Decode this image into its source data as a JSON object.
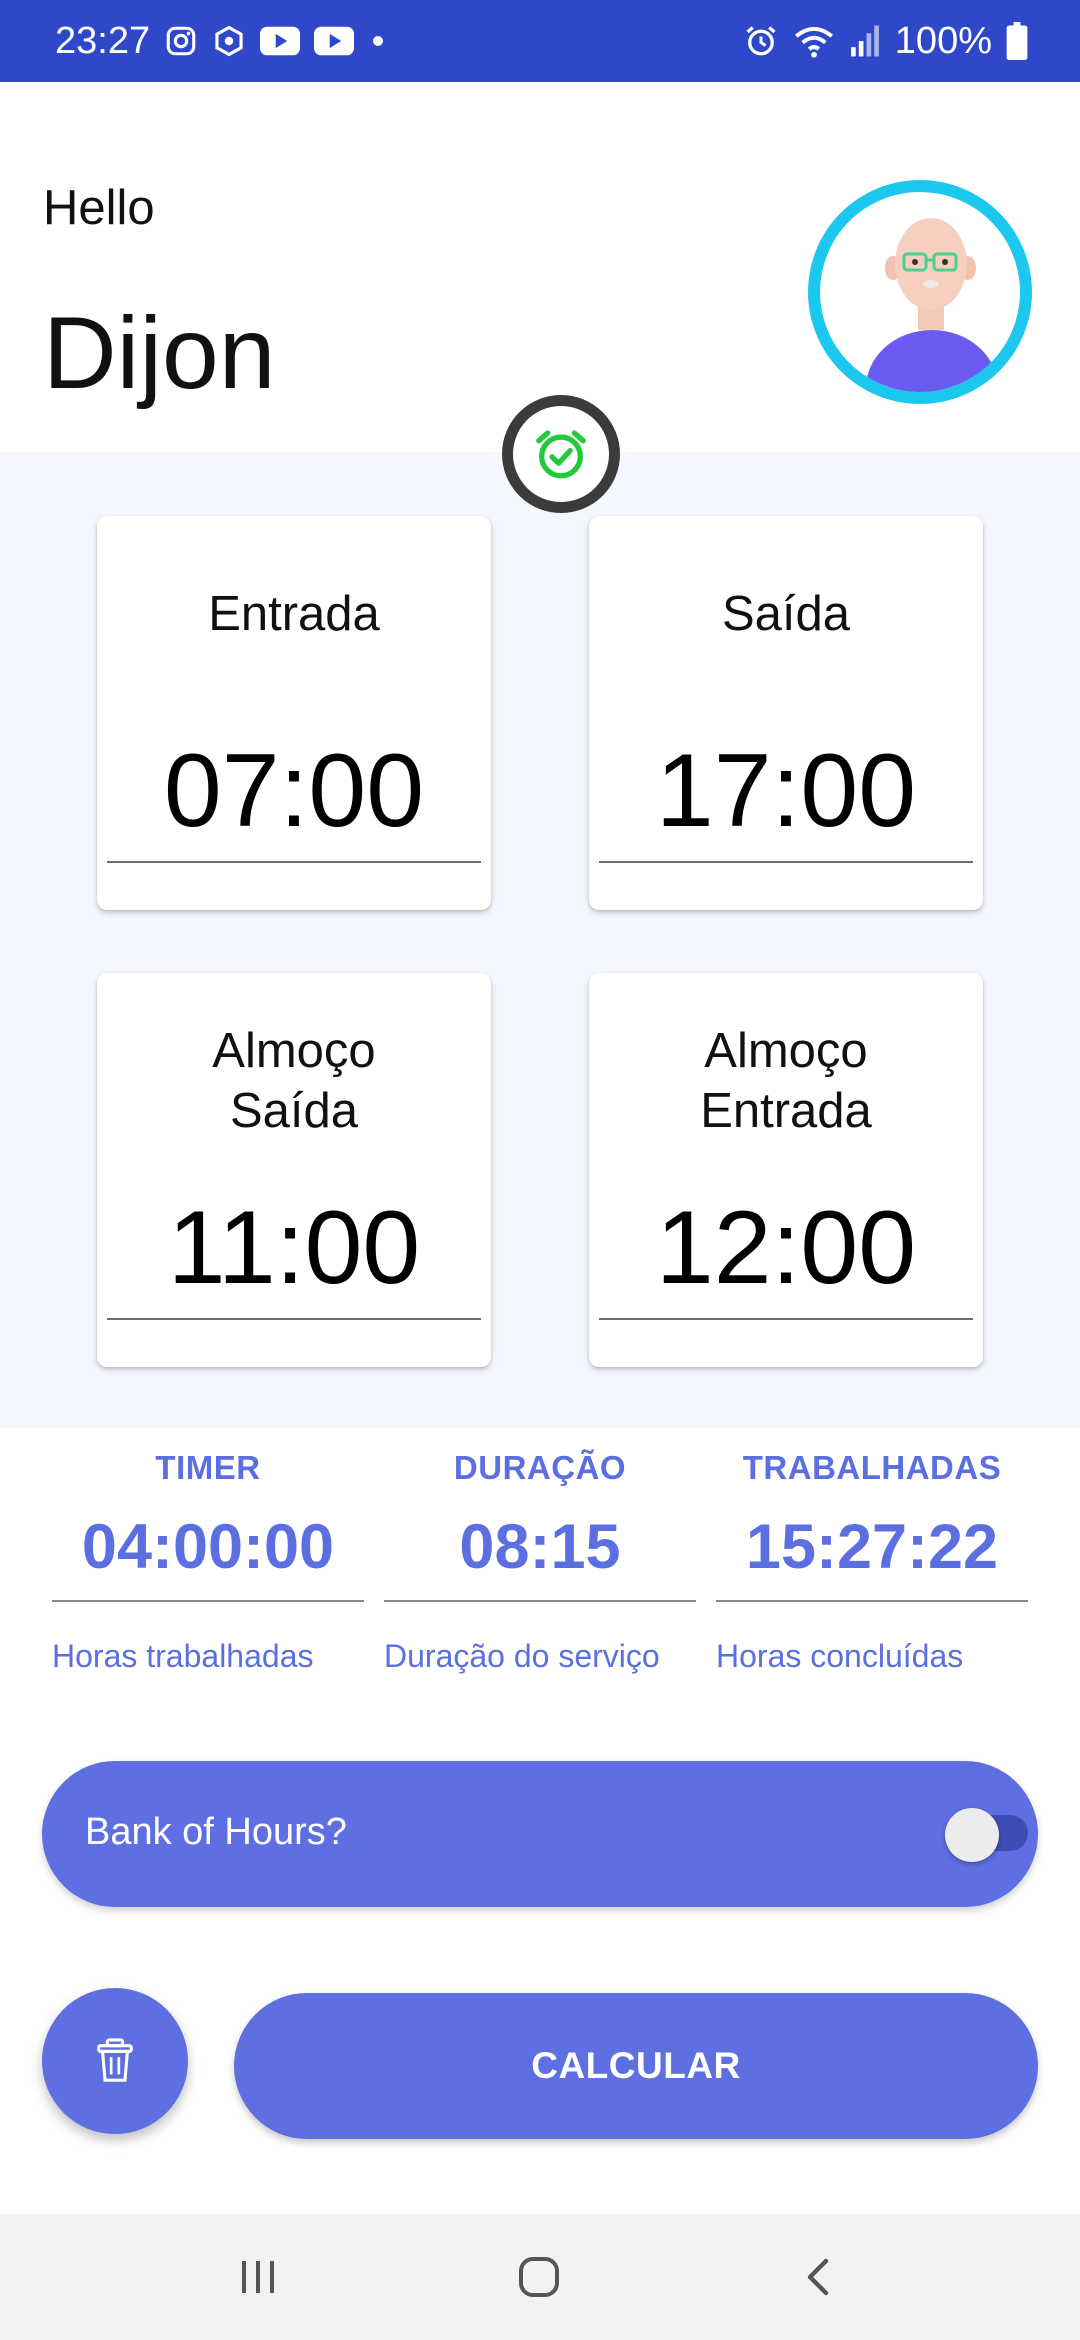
{
  "status_bar": {
    "time": "23:27",
    "battery": "100%",
    "left_icons": [
      "instagram-icon",
      "hexagon-app-icon",
      "youtube-icon",
      "youtube-icon",
      "dot-icon"
    ],
    "right_icons": [
      "alarm-icon",
      "wifi-icon",
      "signal-icon",
      "battery-icon"
    ],
    "background": "#2F48C9"
  },
  "header": {
    "greeting": "Hello",
    "name": "Dijon",
    "avatar_ring_color": "#1CC8EE"
  },
  "alarm_badge": {
    "icon": "alarm-check-icon",
    "color": "#22C93A"
  },
  "time_cards": [
    {
      "label_lines": [
        "Entrada"
      ],
      "time": "07:00"
    },
    {
      "label_lines": [
        "Saída"
      ],
      "time": "17:00"
    },
    {
      "label_lines": [
        "Almoço",
        "Saída"
      ],
      "time": "11:00"
    },
    {
      "label_lines": [
        "Almoço",
        "Entrada"
      ],
      "time": "12:00"
    }
  ],
  "stats": [
    {
      "title": "TIMER",
      "value": "04:00:00",
      "caption": "Horas trabalhadas"
    },
    {
      "title": "DURAÇÃO",
      "value": "08:15",
      "caption": "Duração do serviço"
    },
    {
      "title": "TRABALHADAS",
      "value": "15:27:22",
      "caption": "Horas concluídas"
    }
  ],
  "bank_of_hours": {
    "label": "Bank of Hours?",
    "enabled": false
  },
  "actions": {
    "calculate_label": "CALCULAR",
    "delete_icon": "trash-icon"
  },
  "colors": {
    "accent": "#5E6FE1",
    "panel": "#F4F7FD"
  },
  "nav_bar": {
    "icons": [
      "recent-apps-icon",
      "home-icon",
      "back-icon"
    ]
  }
}
